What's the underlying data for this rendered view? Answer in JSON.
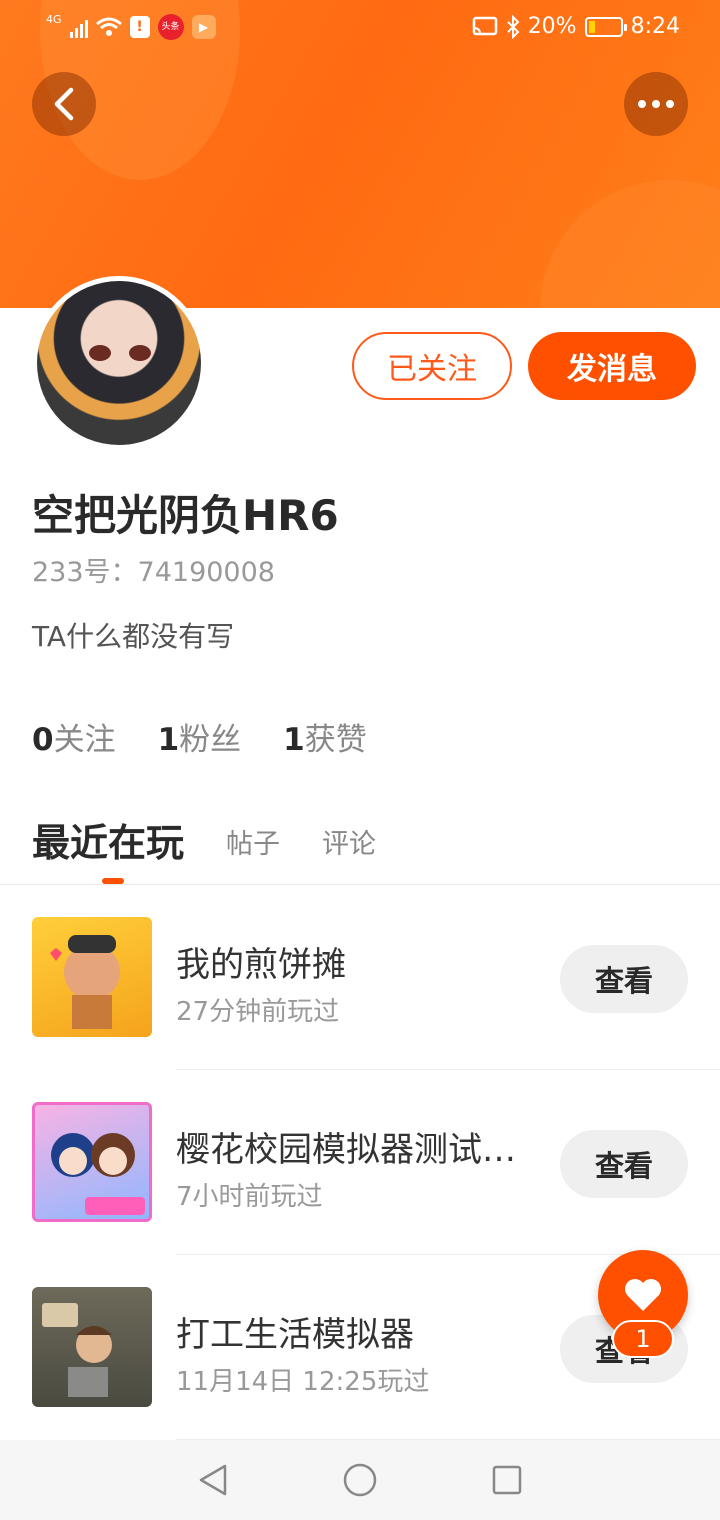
{
  "status_bar": {
    "network": "4G",
    "battery_percent": "20%",
    "time": "8:24",
    "battery_level": 0.2
  },
  "header": {
    "back_icon": "back-arrow-icon",
    "more_icon": "more-dots-icon"
  },
  "profile": {
    "follow_label": "已关注",
    "message_label": "发消息",
    "username": "空把光阴负HR6",
    "uid": "233号：74190008",
    "bio": "TA什么都没有写",
    "stats": [
      {
        "count": "0",
        "label": "关注"
      },
      {
        "count": "1",
        "label": "粉丝"
      },
      {
        "count": "1",
        "label": "获赞"
      }
    ]
  },
  "tabs": {
    "active": "最近在玩",
    "posts": "帖子",
    "comments": "评论"
  },
  "games": [
    {
      "title": "我的煎饼摊",
      "played": "27分钟前玩过",
      "view_label": "查看"
    },
    {
      "title": "樱花校园模拟器测试…",
      "played": "7小时前玩过",
      "view_label": "查看"
    },
    {
      "title": "打工生活模拟器",
      "played": "11月14日 12:25玩过",
      "view_label": "查看"
    }
  ],
  "fab": {
    "icon": "heart-icon",
    "count": "1"
  },
  "colors": {
    "accent": "#ff5000",
    "header_gradient": "#ff7a1e"
  }
}
